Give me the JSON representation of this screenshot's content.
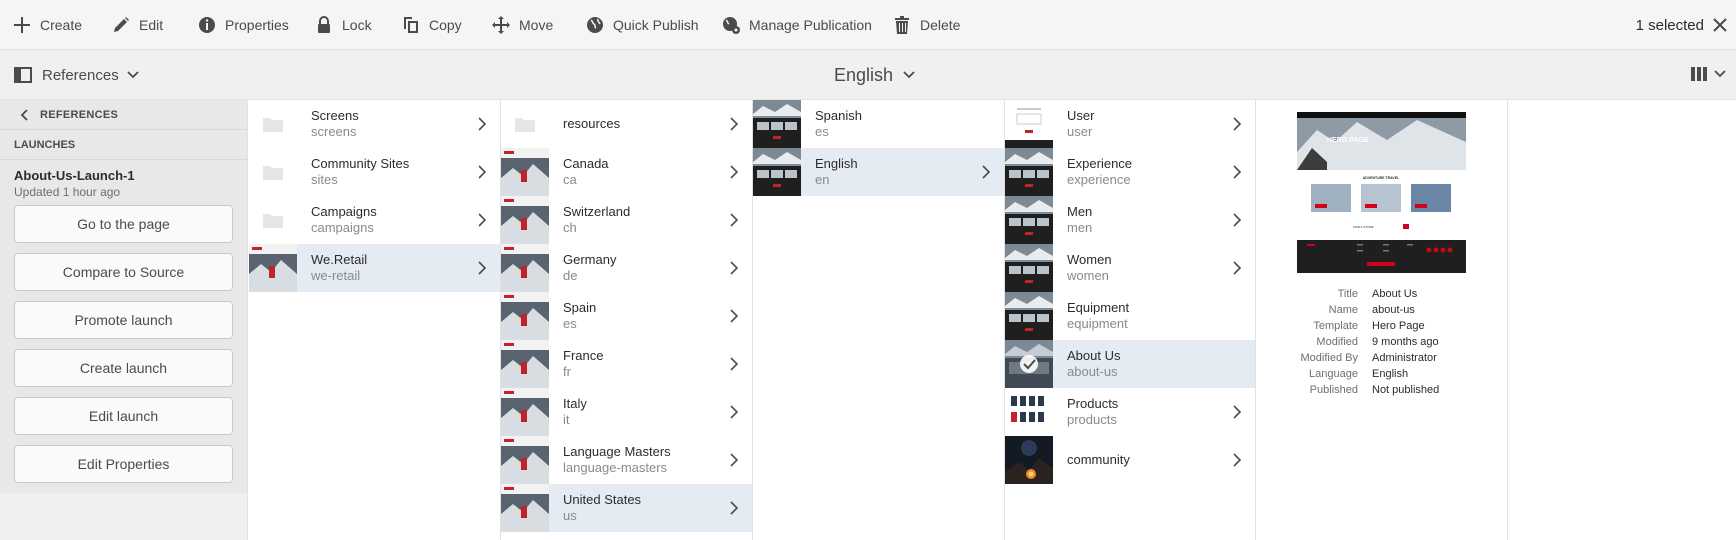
{
  "actions": {
    "create": "Create",
    "edit": "Edit",
    "properties": "Properties",
    "lock": "Lock",
    "copy": "Copy",
    "move": "Move",
    "quick_publish": "Quick Publish",
    "manage_publication": "Manage Publication",
    "delete": "Delete",
    "selected_count": "1 selected"
  },
  "subbar": {
    "rail_label": "References",
    "language": "English"
  },
  "rail": {
    "back_label": "REFERENCES",
    "section_label": "LAUNCHES",
    "launch_name": "About-Us-Launch-1",
    "launch_updated": "Updated 1 hour ago",
    "buttons": [
      "Go to the page",
      "Compare to Source",
      "Promote launch",
      "Create launch",
      "Edit launch",
      "Edit Properties"
    ]
  },
  "columns": {
    "col1": [
      {
        "title": "Screens",
        "name": "screens"
      },
      {
        "title": "Community Sites",
        "name": "sites"
      },
      {
        "title": "Campaigns",
        "name": "campaigns"
      },
      {
        "title": "We.Retail",
        "name": "we-retail"
      }
    ],
    "col2": [
      {
        "title": "resources",
        "name": ""
      },
      {
        "title": "Canada",
        "name": "ca"
      },
      {
        "title": "Switzerland",
        "name": "ch"
      },
      {
        "title": "Germany",
        "name": "de"
      },
      {
        "title": "Spain",
        "name": "es"
      },
      {
        "title": "France",
        "name": "fr"
      },
      {
        "title": "Italy",
        "name": "it"
      },
      {
        "title": "Language Masters",
        "name": "language-masters"
      },
      {
        "title": "United States",
        "name": "us"
      }
    ],
    "col3": [
      {
        "title": "Spanish",
        "name": "es"
      },
      {
        "title": "English",
        "name": "en"
      }
    ],
    "col4": [
      {
        "title": "User",
        "name": "user"
      },
      {
        "title": "Experience",
        "name": "experience"
      },
      {
        "title": "Men",
        "name": "men"
      },
      {
        "title": "Women",
        "name": "women"
      },
      {
        "title": "Equipment",
        "name": "equipment"
      },
      {
        "title": "About Us",
        "name": "about-us"
      },
      {
        "title": "Products",
        "name": "products"
      },
      {
        "title": "community",
        "name": ""
      }
    ]
  },
  "preview": {
    "hero_text": "HERO PAGE",
    "section_heading": "ADVENTURE TRAVEL",
    "cta_label": "FIND A STORE"
  },
  "details": [
    {
      "key": "Title",
      "value": "About Us"
    },
    {
      "key": "Name",
      "value": "about-us"
    },
    {
      "key": "Template",
      "value": "Hero Page"
    },
    {
      "key": "Modified",
      "value": "9 months ago"
    },
    {
      "key": "Modified By",
      "value": "Administrator"
    },
    {
      "key": "Language",
      "value": "English"
    },
    {
      "key": "Published",
      "value": "Not published"
    }
  ],
  "colors": {
    "selected_row": "#e5ebf3",
    "brand_red": "#d0021b",
    "action_text": "#4b4b4b"
  },
  "icons": [
    "plus-icon",
    "pencil-icon",
    "info-icon",
    "lock-icon",
    "copy-icon",
    "move-icon",
    "globe-icon",
    "globe-gear-icon",
    "trash-icon",
    "close-icon",
    "rail-icon",
    "chevron-down-icon",
    "chevron-left-icon",
    "chevron-right-icon",
    "folder-icon",
    "column-view-icon",
    "checkmark-icon"
  ]
}
